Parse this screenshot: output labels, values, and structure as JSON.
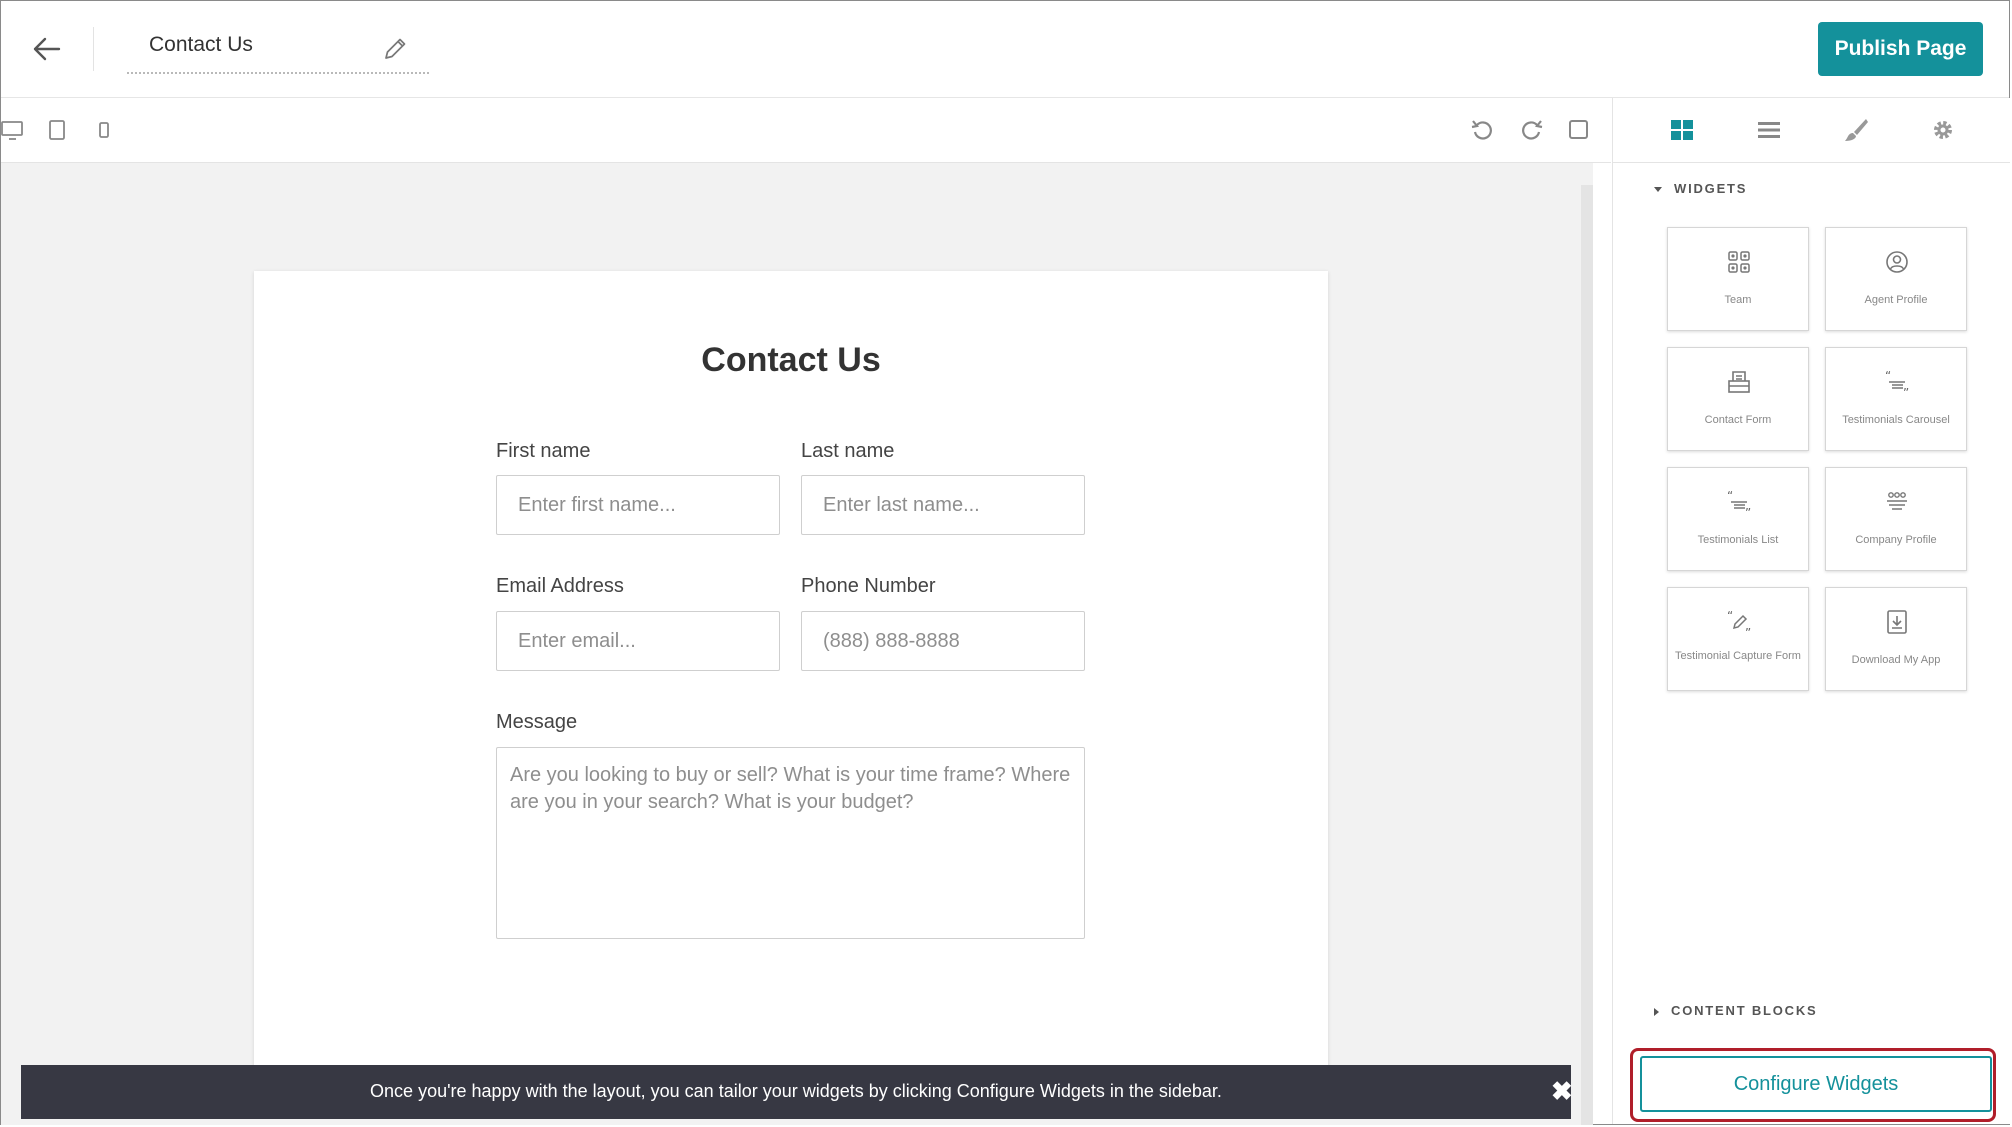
{
  "header": {
    "page_name": "Contact Us",
    "publish_label": "Publish Page"
  },
  "toolbar": {
    "view_icons": [
      "desktop-icon",
      "tablet-icon",
      "mobile-icon"
    ],
    "action_icons": [
      "undo-icon",
      "redo-icon",
      "preview-icon"
    ]
  },
  "form": {
    "title": "Contact Us",
    "first_name_label": "First name",
    "first_name_placeholder": "Enter first name...",
    "last_name_label": "Last name",
    "last_name_placeholder": "Enter last name...",
    "email_label": "Email Address",
    "email_placeholder": "Enter email...",
    "phone_label": "Phone Number",
    "phone_placeholder": "(888) 888-8888",
    "message_label": "Message",
    "message_placeholder": "Are you looking to buy or sell? What is your time frame? Where are you in your search? What is your budget?"
  },
  "toast": {
    "message": "Once you're happy with the layout, you can tailor your widgets by clicking Configure Widgets in the sidebar.",
    "close_symbol": "✖"
  },
  "sidebar": {
    "tabs": [
      "widgets-grid-icon",
      "list-icon",
      "brush-icon",
      "gear-icon"
    ],
    "widgets_heading": "WIDGETS",
    "widgets": [
      {
        "label": "Team",
        "icon": "team-icon"
      },
      {
        "label": "Agent Profile",
        "icon": "agent-profile-icon"
      },
      {
        "label": "Contact Form",
        "icon": "contact-form-icon"
      },
      {
        "label": "Testimonials Carousel",
        "icon": "quote-icon"
      },
      {
        "label": "Testimonials List",
        "icon": "quote-icon"
      },
      {
        "label": "Company Profile",
        "icon": "company-profile-icon"
      },
      {
        "label": "Testimonial Capture Form",
        "icon": "quote-pen-icon"
      },
      {
        "label": "Download My App",
        "icon": "download-icon"
      }
    ],
    "content_blocks_heading": "CONTENT BLOCKS",
    "configure_label": "Configure Widgets"
  },
  "colors": {
    "accent": "#14919b",
    "toast_bg": "#373843",
    "highlight_outline": "#b01e2a",
    "canvas_bg": "#f2f2f2"
  }
}
